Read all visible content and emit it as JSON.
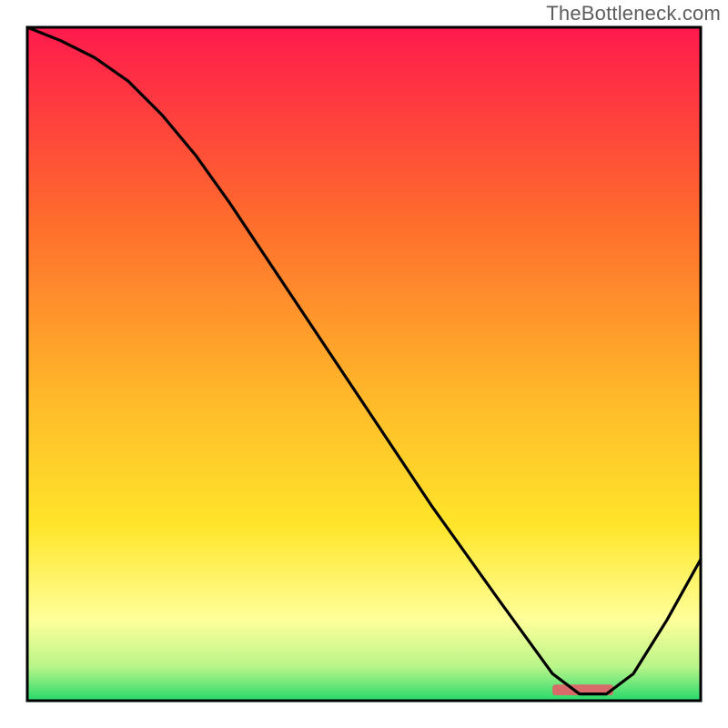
{
  "watermark": "TheBottleneck.com",
  "colors": {
    "gradient_top": "#ff1a4d",
    "gradient_mid_1": "#ff6a2d",
    "gradient_mid_2": "#ffb92a",
    "gradient_mid_3": "#ffe52a",
    "gradient_low": "#ffff9a",
    "gradient_base": "#27d96b",
    "line": "#000000",
    "optimal_fill": "#d86a6a"
  },
  "chart_data": {
    "type": "line",
    "title": "",
    "xlabel": "",
    "ylabel": "",
    "xlim": [
      0,
      100
    ],
    "ylim": [
      0,
      100
    ],
    "series": [
      {
        "name": "bottleneck-curve",
        "x": [
          0,
          5,
          10,
          15,
          20,
          25,
          30,
          40,
          50,
          60,
          70,
          78,
          82,
          86,
          90,
          95,
          100
        ],
        "y": [
          100,
          98,
          95.5,
          92,
          87,
          81,
          74,
          59,
          44,
          29,
          15,
          4,
          1,
          1,
          4,
          12,
          21
        ]
      }
    ],
    "optimal_band": {
      "x_start": 78,
      "x_end": 87,
      "y": 0.8,
      "height": 1.6
    }
  }
}
